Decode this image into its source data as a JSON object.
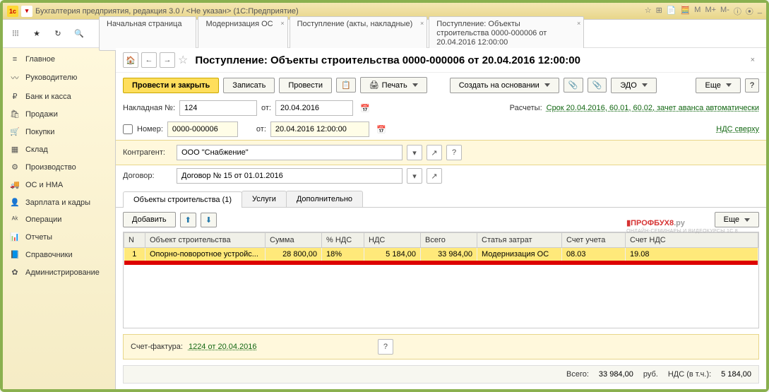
{
  "window": {
    "title": "Бухгалтерия предприятия, редакция 3.0 / <Не указан>  (1С:Предприятие)",
    "rightIcons": [
      "M",
      "M+",
      "M-"
    ]
  },
  "topTabs": [
    {
      "label": "Начальная страница"
    },
    {
      "label": "Модернизация ОС"
    },
    {
      "label": "Поступление (акты, накладные)"
    },
    {
      "label": "Поступление: Объекты строительства 0000-000006 от 20.04.2016 12:00:00"
    }
  ],
  "sidebar": [
    {
      "icon": "≡",
      "label": "Главное"
    },
    {
      "icon": "〰",
      "label": "Руководителю"
    },
    {
      "icon": "₽",
      "label": "Банк и касса"
    },
    {
      "icon": "🛍",
      "label": "Продажи"
    },
    {
      "icon": "🛒",
      "label": "Покупки"
    },
    {
      "icon": "▦",
      "label": "Склад"
    },
    {
      "icon": "⚙",
      "label": "Производство"
    },
    {
      "icon": "🚚",
      "label": "ОС и НМА"
    },
    {
      "icon": "👤",
      "label": "Зарплата и кадры"
    },
    {
      "icon": "ᴬᵏ",
      "label": "Операции"
    },
    {
      "icon": "📊",
      "label": "Отчеты"
    },
    {
      "icon": "📘",
      "label": "Справочники"
    },
    {
      "icon": "✿",
      "label": "Администрирование"
    }
  ],
  "page": {
    "title": "Поступление: Объекты строительства 0000-000006 от 20.04.2016 12:00:00",
    "btn_primary": "Провести и закрыть",
    "btn_write": "Записать",
    "btn_post": "Провести",
    "btn_print": "Печать",
    "btn_create": "Создать на основании",
    "btn_edo": "ЭДО",
    "btn_more": "Еще"
  },
  "fields": {
    "invoice_label": "Накладная  №:",
    "invoice_no": "124",
    "date_label": "от:",
    "invoice_date": "20.04.2016",
    "number_label": "Номер:",
    "number": "0000-000006",
    "datetime": "20.04.2016 12:00:00",
    "settlements_label": "Расчеты:",
    "settlements": "Срок 20.04.2016, 60.01, 60.02, зачет аванса автоматически",
    "vat_label": "НДС сверху",
    "counterparty_label": "Контрагент:",
    "counterparty": "ООО \"Снабжение\"",
    "contract_label": "Договор:",
    "contract": "Договор № 15 от 01.01.2016"
  },
  "innerTabs": {
    "objects": "Объекты строительства (1)",
    "services": "Услуги",
    "extra": "Дополнительно"
  },
  "tableActions": {
    "add": "Добавить",
    "more": "Еще"
  },
  "table": {
    "headers": [
      "N",
      "Объект строительства",
      "Сумма",
      "% НДС",
      "НДС",
      "Всего",
      "Статья затрат",
      "Счет учета",
      "Счет НДС"
    ],
    "row": [
      "1",
      "Опорно-поворотное устройс...",
      "28 800,00",
      "18%",
      "5 184,00",
      "33 984,00",
      "Модернизация ОС",
      "08.03",
      "19.08"
    ]
  },
  "footer": {
    "sf_label": "Счет-фактура:",
    "sf_link": "1224 от 20.04.2016",
    "total_label": "Всего:",
    "total": "33 984,00",
    "currency": "руб.",
    "vat_label": "НДС (в т.ч.):",
    "vat": "5 184,00"
  },
  "watermark": {
    "main": "ПРОФБУХ8",
    "suffix": ".ру",
    "sub": "ОНЛАЙН-СЕМИНАРЫ И ВИДЕОКУРСЫ 1С 8"
  }
}
